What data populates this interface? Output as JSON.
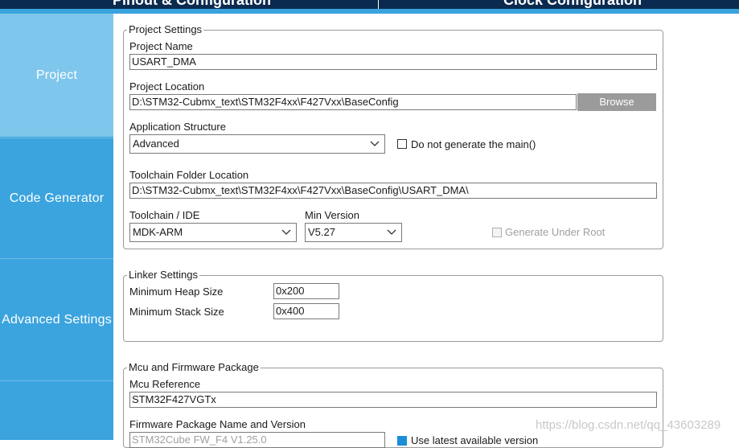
{
  "top_tabs": [
    "Pinout & Configuration",
    "Clock Configuration"
  ],
  "sidebar": {
    "items": [
      {
        "label": "Project",
        "active": true
      },
      {
        "label": "Code Generator",
        "active": false
      },
      {
        "label": "Advanced Settings",
        "active": false
      },
      {
        "label": "",
        "active": false
      }
    ]
  },
  "project_settings": {
    "title": "Project Settings",
    "project_name_label": "Project Name",
    "project_name": "USART_DMA",
    "project_location_label": "Project Location",
    "project_location": "D:\\STM32-Cubmx_text\\STM32F4xx\\F427Vxx\\BaseConfig",
    "browse_label": "Browse",
    "app_structure_label": "Application Structure",
    "app_structure": "Advanced",
    "no_main_label": "Do not generate the main()",
    "no_main_checked": false,
    "toolchain_folder_label": "Toolchain Folder Location",
    "toolchain_folder": "D:\\STM32-Cubmx_text\\STM32F4xx\\F427Vxx\\BaseConfig\\USART_DMA\\",
    "toolchain_ide_label": "Toolchain / IDE",
    "toolchain_ide": "MDK-ARM",
    "min_version_label": "Min Version",
    "min_version": "V5.27",
    "generate_under_root_label": "Generate Under Root",
    "generate_under_root_enabled": false
  },
  "linker_settings": {
    "title": "Linker Settings",
    "heap_label": "Minimum Heap Size",
    "heap_value": "0x200",
    "stack_label": "Minimum Stack Size",
    "stack_value": "0x400"
  },
  "mcu_package": {
    "title": "Mcu and Firmware Package",
    "mcu_ref_label": "Mcu Reference",
    "mcu_ref": "STM32F427VGTx",
    "fw_label": "Firmware Package Name and Version",
    "fw_value": "STM32Cube FW_F4 V1.25.0",
    "use_latest_label": "Use latest available version",
    "use_latest_checked": true
  },
  "watermark": "https://blog.csdn.net/qq_43603289",
  "colors": {
    "sidebar": "#3ba4de",
    "sidebar_active": "#7fc6ec",
    "topbar": "#0b2a4f",
    "button": "#9b9b9b"
  }
}
